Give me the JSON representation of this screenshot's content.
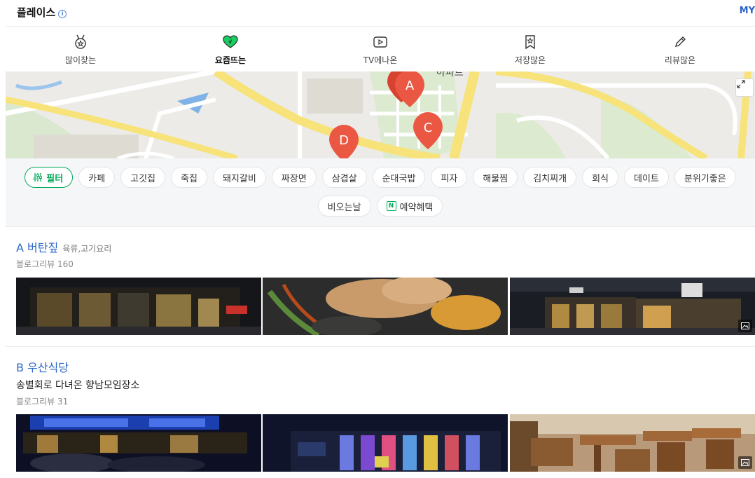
{
  "header": {
    "title": "플레이스",
    "my_label": "MY"
  },
  "tabs": [
    {
      "label": "많이찾는",
      "icon": "medal-icon",
      "active": false
    },
    {
      "label": "요즘뜨는",
      "icon": "heart-icon",
      "active": true
    },
    {
      "label": "TV에나온",
      "icon": "tv-play-icon",
      "active": false
    },
    {
      "label": "저장많은",
      "icon": "bookmark-star-icon",
      "active": false
    },
    {
      "label": "리뷰많은",
      "icon": "pen-icon",
      "active": false
    }
  ],
  "map": {
    "markers": [
      "A",
      "C",
      "D"
    ],
    "map_text": "아파트",
    "marker_color": "#e8513d"
  },
  "chips": {
    "filter_label": "필터",
    "row1": [
      "카페",
      "고깃집",
      "죽집",
      "돼지갈비",
      "짜장면",
      "삼겹살",
      "순대국밥",
      "피자",
      "해물찜",
      "김치찌개",
      "회식",
      "데이트",
      "분위기좋은"
    ],
    "row2_first": "비오는날",
    "reserve_badge": "N",
    "reserve_label": "예약혜택"
  },
  "places": [
    {
      "marker": "A",
      "name": "버탄짚",
      "category": "육류,고기요리",
      "description": "",
      "review": "블로그리뷰 160"
    },
    {
      "marker": "B",
      "name": "우산식당",
      "category": "",
      "description": "송별회로 다녀온 향남모임장소",
      "review": "블로그리뷰 31"
    }
  ],
  "colors": {
    "accent_green": "#03aa5a",
    "link_blue": "#2c68c9",
    "active_heart": "#19ce60"
  }
}
